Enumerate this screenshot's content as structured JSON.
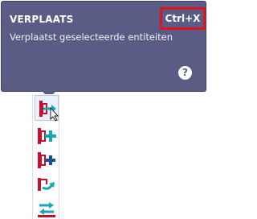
{
  "tooltip": {
    "title": "VERPLAATS",
    "shortcut": "Ctrl+X",
    "description": "Verplaatst geselecteerde entiteiten",
    "help_glyph": "?"
  },
  "toolbar": {
    "tools": [
      {
        "icon": "move-entity-icon",
        "state": "active-hover"
      },
      {
        "icon": "insert-entity-icon"
      },
      {
        "icon": "copy-entity-icon"
      },
      {
        "icon": "rotate-entity-icon"
      },
      {
        "icon": "swap-entity-icon"
      }
    ]
  },
  "colors": {
    "tooltip_bg": "#5a5c85",
    "shortcut_highlight": "#e0141e",
    "icon_red": "#c8102e",
    "icon_teal": "#17a6b4"
  }
}
